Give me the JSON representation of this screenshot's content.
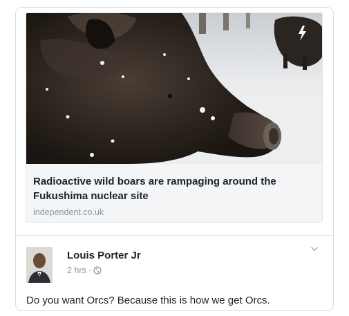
{
  "link_preview": {
    "headline": "Radioactive wild boars are rampaging around the Fukushima nuclear site",
    "domain": "independent.co.uk",
    "image_icon": "boar-photo"
  },
  "post": {
    "author": "Louis Porter Jr",
    "time": "2 hrs",
    "separator": "·",
    "privacy_icon": "globe-icon",
    "menu_icon": "chevron-down-icon",
    "text": "Do you want Orcs? Because this is how we get Orcs."
  },
  "colors": {
    "headline": "#1d2129",
    "meta": "#90949c",
    "border": "#d9dbdf",
    "preview_bg": "#f4f5f7"
  }
}
